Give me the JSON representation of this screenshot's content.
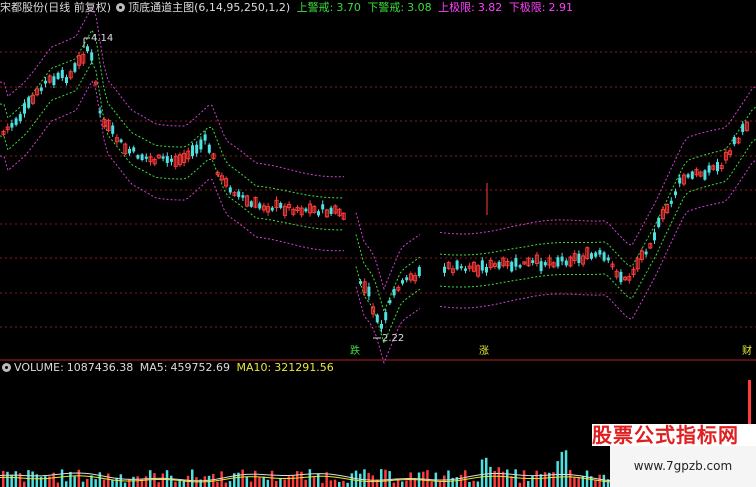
{
  "app": {
    "stock_name": "宋都股份(日线 前复权)",
    "indicator_name": "顶底通道主图(6,14,95,250,1,2)",
    "indicators": [
      {
        "label": "上警戒:",
        "value": "3.70",
        "color": "#3ddc3d"
      },
      {
        "label": "下警戒:",
        "value": "3.08",
        "color": "#3ddc3d"
      },
      {
        "label": "上极限:",
        "value": "3.82",
        "color": "#ff40ff"
      },
      {
        "label": "下极限:",
        "value": "2.91",
        "color": "#ff40ff"
      }
    ]
  },
  "price_labels": {
    "high": "4.14",
    "low": "2.22"
  },
  "signals": {
    "die": "跌",
    "zhang": "涨",
    "cai": "财"
  },
  "volume": {
    "volume_label": "VOLUME:",
    "volume_value": "1087436.38",
    "ma5_label": "MA5:",
    "ma5_value": "459752.69",
    "ma10_label": "MA10:",
    "ma10_value": "321291.56"
  },
  "watermark": {
    "text": "股票公式指标网",
    "url": "www.7gpzb.com"
  },
  "colors": {
    "up": "#ff3b3b",
    "down": "#4fe0e0",
    "green_band": "#3ddc3d",
    "magenta_band": "#d040d0",
    "grid": "#8a1c1c",
    "label_yellow": "#e8e838"
  }
}
